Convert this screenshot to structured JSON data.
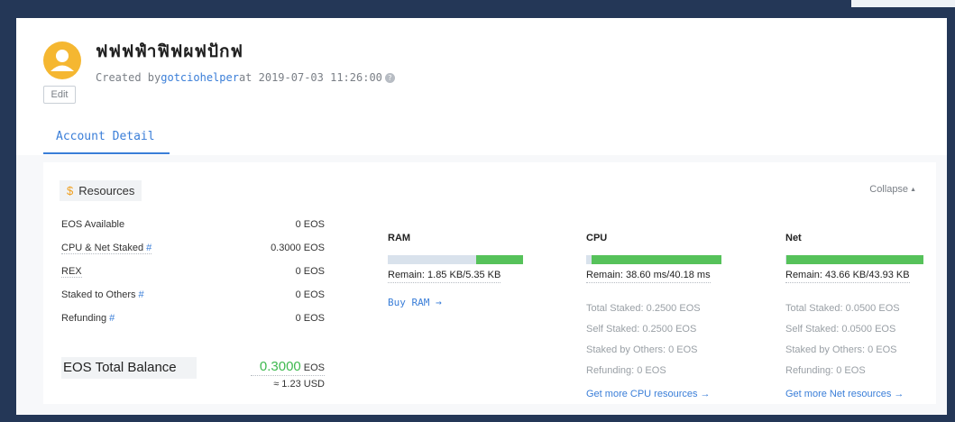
{
  "account": {
    "name": "ฟฟฟฟำฟิฟผฟปักฟ",
    "created_prefix": "Created by",
    "creator": "gotciohelper",
    "created_at": "at 2019-07-03 11:26:00",
    "edit_label": "Edit"
  },
  "tabs": [
    {
      "label": "Account Detail",
      "active": true
    }
  ],
  "resources": {
    "title": "Resources",
    "collapse_label": "Collapse",
    "balances": [
      {
        "label": "EOS Available",
        "value": "0 EOS"
      },
      {
        "label": "CPU & Net Staked",
        "value": "0.3000 EOS",
        "hash": "#"
      },
      {
        "label": "REX",
        "value": "0 EOS"
      },
      {
        "label": "Staked to Others",
        "value": "0 EOS",
        "hash": "#"
      },
      {
        "label": "Refunding",
        "value": "0 EOS",
        "hash": "#"
      }
    ],
    "total": {
      "label": "EOS Total Balance",
      "amount": "0.3000",
      "unit": "EOS",
      "usd": "≈ 1.23 USD"
    },
    "ram": {
      "title": "RAM",
      "remain": "Remain: 1.85 KB/5.35 KB",
      "remain_fraction": 0.346,
      "buy_label": "Buy RAM →"
    },
    "cpu": {
      "title": "CPU",
      "remain": "Remain: 38.60 ms/40.18 ms",
      "remain_fraction": 0.961,
      "total_staked": "Total Staked: 0.2500 EOS",
      "self_staked": "Self Staked: 0.2500 EOS",
      "staked_by_others": "Staked by Others: 0 EOS",
      "refunding": "Refunding: 0 EOS",
      "more_label": "Get more CPU resources →"
    },
    "net": {
      "title": "Net",
      "remain": "Remain: 43.66 KB/43.93 KB",
      "remain_fraction": 0.994,
      "total_staked": "Total Staked: 0.0500 EOS",
      "self_staked": "Self Staked: 0.0500 EOS",
      "staked_by_others": "Staked by Others: 0 EOS",
      "refunding": "Refunding: 0 EOS",
      "more_label": "Get more Net resources →"
    }
  },
  "colors": {
    "accent": "#3a7ed8",
    "bar_fill": "#56c25a",
    "bar_track": "#d9e2ec",
    "avatar": "#f5b731",
    "total_amount": "#3fb950"
  }
}
